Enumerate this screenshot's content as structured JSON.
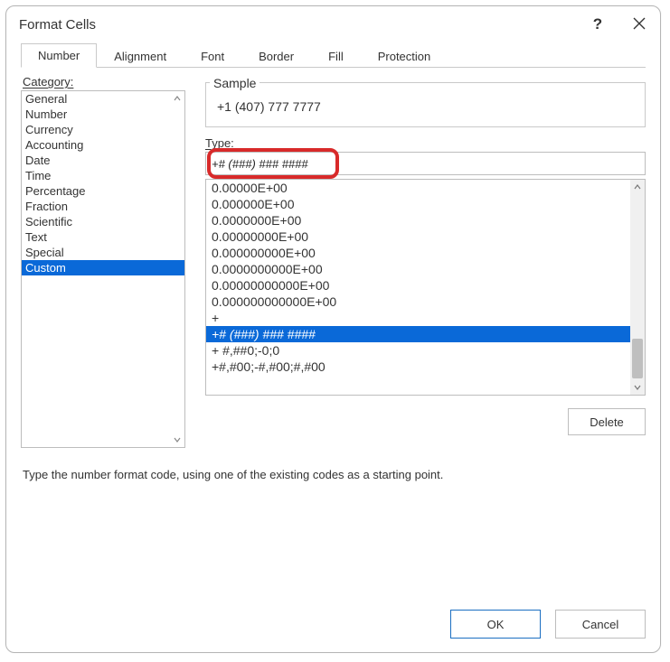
{
  "dialog": {
    "title": "Format Cells",
    "help_tooltip": "Help",
    "close_tooltip": "Close"
  },
  "tabs": [
    {
      "label": "Number",
      "selected": true
    },
    {
      "label": "Alignment",
      "selected": false
    },
    {
      "label": "Font",
      "selected": false
    },
    {
      "label": "Border",
      "selected": false
    },
    {
      "label": "Fill",
      "selected": false
    },
    {
      "label": "Protection",
      "selected": false
    }
  ],
  "category_label": "Category:",
  "categories": [
    {
      "label": "General"
    },
    {
      "label": "Number"
    },
    {
      "label": "Currency"
    },
    {
      "label": "Accounting"
    },
    {
      "label": "Date"
    },
    {
      "label": "Time"
    },
    {
      "label": "Percentage"
    },
    {
      "label": "Fraction"
    },
    {
      "label": "Scientific"
    },
    {
      "label": "Text"
    },
    {
      "label": "Special"
    },
    {
      "label": "Custom",
      "selected": true
    }
  ],
  "sample": {
    "label": "Sample",
    "value": "+1 (407) 777 7777"
  },
  "type": {
    "label": "Type:",
    "value": "+# (###) ### ####"
  },
  "type_list": [
    {
      "label": "0.00000E+00"
    },
    {
      "label": "0.000000E+00"
    },
    {
      "label": "0.0000000E+00"
    },
    {
      "label": "0.00000000E+00"
    },
    {
      "label": "0.000000000E+00"
    },
    {
      "label": "0.0000000000E+00"
    },
    {
      "label": "0.00000000000E+00"
    },
    {
      "label": "0.000000000000E+00"
    },
    {
      "label": "+"
    },
    {
      "label": "+# (###) ### ####",
      "selected": true
    },
    {
      "label": "+ #,##0;-0;0"
    },
    {
      "label": "+#,#00;-#,#00;#,#00"
    }
  ],
  "buttons": {
    "delete": "Delete",
    "ok": "OK",
    "cancel": "Cancel"
  },
  "description": "Type the number format code, using one of the existing codes as a starting point."
}
